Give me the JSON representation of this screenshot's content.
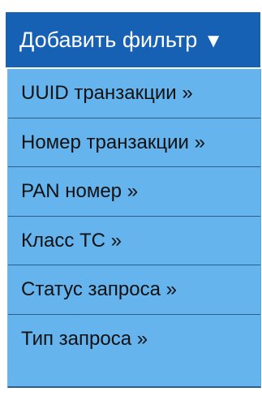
{
  "filter_dropdown": {
    "button_label": "Добавить фильтр",
    "caret": "▼",
    "items": [
      {
        "label": "UUID транзакции »"
      },
      {
        "label": "Номер транзакции »"
      },
      {
        "label": "PAN номер »"
      },
      {
        "label": "Класс ТС »"
      },
      {
        "label": "Статус запроса »"
      },
      {
        "label": "Тип запроса »"
      }
    ]
  }
}
